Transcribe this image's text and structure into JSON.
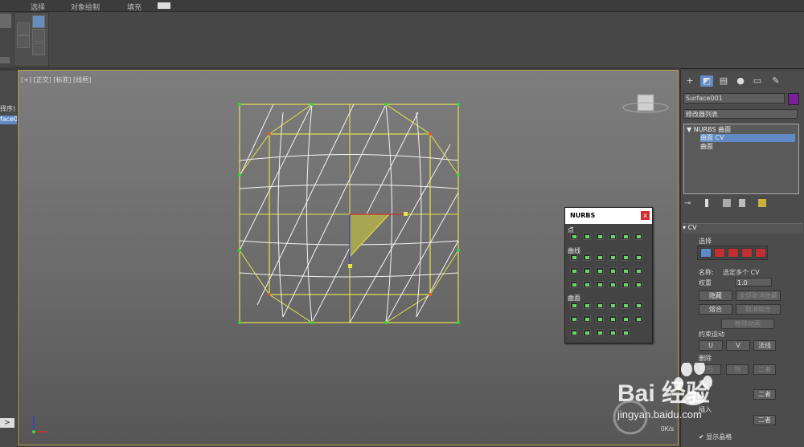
{
  "menu": {
    "items": [
      "选择",
      "对象绘制",
      "填充"
    ]
  },
  "viewport": {
    "label": "[+] [正交] [标准] [线框]"
  },
  "left_panel": {
    "label1": "择序)",
    "label2": "face0"
  },
  "command_panel": {
    "object_name": "Surface001",
    "object_color": "#7a1f9a",
    "modifier_list": "修改器列表",
    "stack": {
      "root": "NURBS 曲面",
      "items": [
        "曲面 CV",
        "曲面"
      ]
    },
    "rollout_title": "CV",
    "select_label": "选择",
    "name_label": "名称:",
    "name_value": "选定多个 CV",
    "weight_label": "权重",
    "weight_value": "1.0",
    "buttons": {
      "hide": "隐藏",
      "unhide_all": "全部取消隐藏",
      "fuse": "熔合",
      "unfuse": "取消熔合",
      "remove_anim": "移除动画"
    },
    "constrain_label": "约束运动",
    "constrain": [
      "U",
      "V",
      "法线"
    ],
    "delete_label": "删除",
    "delete_buttons": [
      "行",
      "列",
      "二者"
    ],
    "refine_label": "优化",
    "refine_btn": "二者",
    "insert_label": "插入",
    "insert_btn": "二者",
    "show_lattice": "显示晶格"
  },
  "nurbs_toolbox": {
    "title": "NURBS",
    "close": "x",
    "sections": [
      "点",
      "曲线",
      "曲面"
    ]
  },
  "watermark": {
    "brand_text": "Bai 经验",
    "url": "jingyan.baidu.com",
    "badge": "0K/s"
  },
  "colors": {
    "lattice": "#e5e34a",
    "wire": "#f4f4f4",
    "viewport_border": "#b8a24a",
    "selection": "#5f8ac4"
  }
}
